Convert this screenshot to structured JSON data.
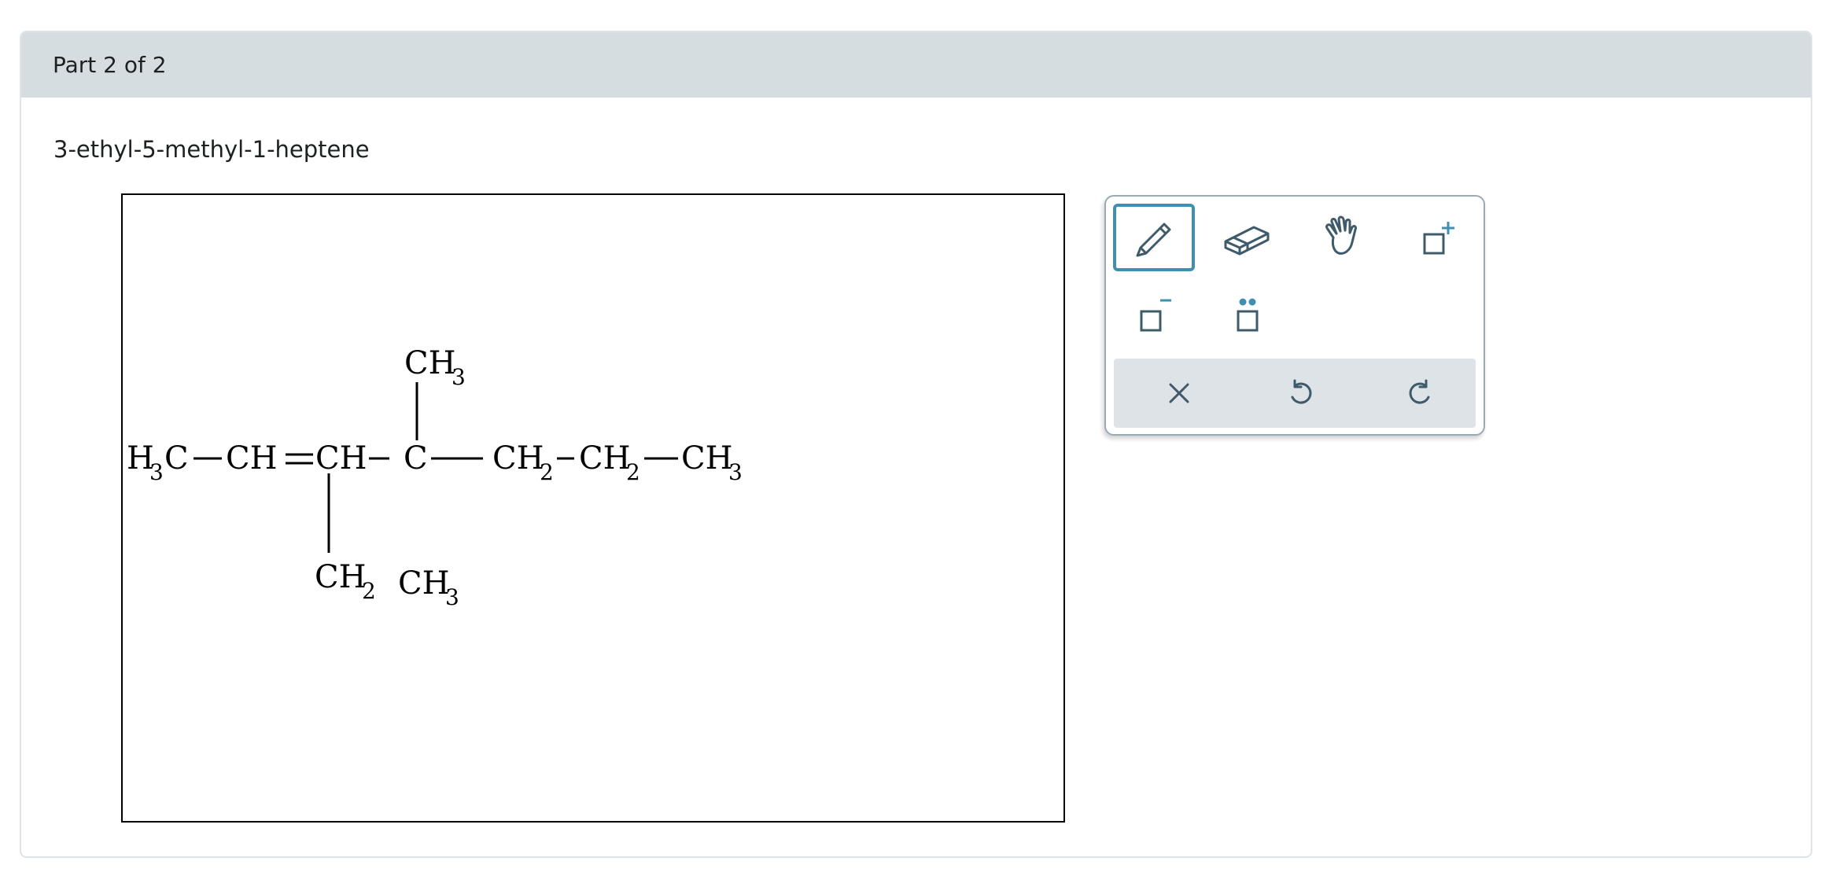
{
  "header": {
    "part_label": "Part 2 of 2"
  },
  "question": {
    "compound_name": "3-ethyl-5-methyl-1-heptene"
  },
  "structure": {
    "left_group": "H",
    "left_group_sub": "3",
    "left_group_tail": "C",
    "ch1": "CH",
    "ch2": "CH",
    "quaternary_c": "C",
    "ch2_a": "CH",
    "ch2_a_sub": "2",
    "ch2_b": "CH",
    "ch2_b_sub": "2",
    "ch3_end": "CH",
    "ch3_end_sub": "3",
    "top_branch": "CH",
    "top_branch_sub": "3",
    "bottom_branch": "CH",
    "bottom_branch_sub": "2",
    "bottom_methyl": "CH",
    "bottom_methyl_sub": "3"
  },
  "toolbar": {
    "tools": [
      {
        "name": "pencil-icon",
        "selected": true
      },
      {
        "name": "eraser-icon",
        "selected": false
      },
      {
        "name": "hand-icon",
        "selected": false
      },
      {
        "name": "positive-charge-icon",
        "selected": false
      },
      {
        "name": "negative-charge-icon",
        "selected": false
      },
      {
        "name": "lone-pair-icon",
        "selected": false
      }
    ],
    "actions": [
      "clear-icon",
      "undo-icon",
      "redo-icon"
    ]
  },
  "colors": {
    "header_bg": "#d6dde1",
    "accent": "#3e8fb0",
    "icon": "#3f5b6b",
    "action_bar_bg": "#dde3e6"
  }
}
